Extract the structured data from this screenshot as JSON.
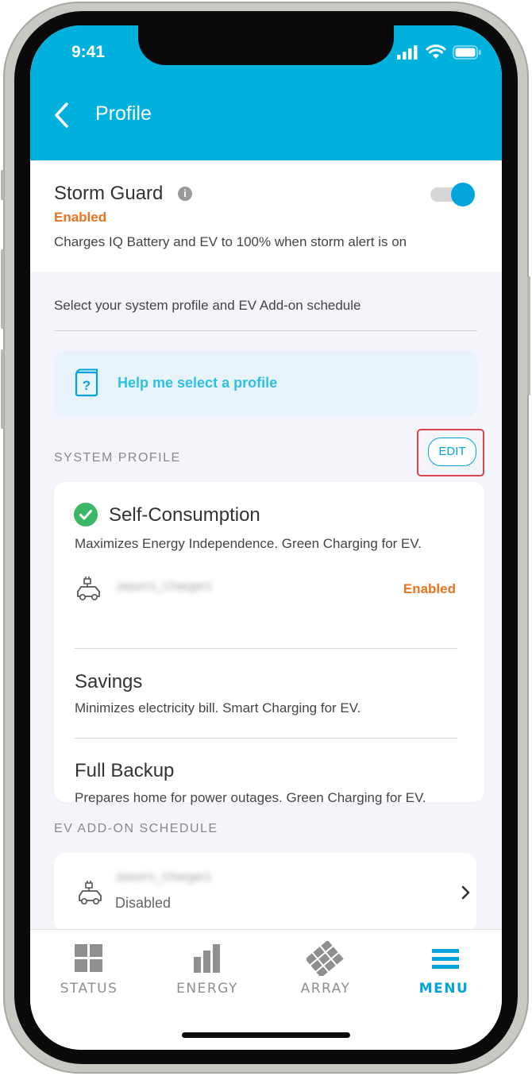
{
  "status_bar": {
    "time": "9:41"
  },
  "header": {
    "title": "Profile"
  },
  "storm_guard": {
    "title": "Storm Guard",
    "status": "Enabled",
    "description": "Charges IQ Battery and EV to 100% when storm alert is on",
    "toggle_on": true
  },
  "intro": "Select your system profile and EV Add-on schedule",
  "help_link": "Help me select a profile",
  "system_profile": {
    "section_label": "SYSTEM PROFILE",
    "edit_label": "EDIT",
    "options": [
      {
        "title": "Self-Consumption",
        "description": "Maximizes Energy Independence. Green Charging for EV.",
        "selected": true,
        "charger": {
          "name": "Jason's_Charger1",
          "status": "Enabled"
        }
      },
      {
        "title": "Savings",
        "description": "Minimizes electricity bill. Smart Charging for EV."
      },
      {
        "title": "Full Backup",
        "description": "Prepares home for power outages. Green Charging for EV."
      }
    ]
  },
  "ev_schedule": {
    "section_label": "EV ADD-ON SCHEDULE",
    "charger_name": "Jason's_Charger1",
    "status": "Disabled"
  },
  "tabs": [
    {
      "label": "STATUS",
      "icon": "status-grid-icon",
      "active": false
    },
    {
      "label": "ENERGY",
      "icon": "energy-bars-icon",
      "active": false
    },
    {
      "label": "ARRAY",
      "icon": "array-panels-icon",
      "active": false
    },
    {
      "label": "MENU",
      "icon": "menu-icon",
      "active": true
    }
  ],
  "colors": {
    "accent": "#01b1dd",
    "enabled_orange": "#e9741e",
    "check_green": "#3cb766",
    "highlight_red": "#d6464f"
  }
}
